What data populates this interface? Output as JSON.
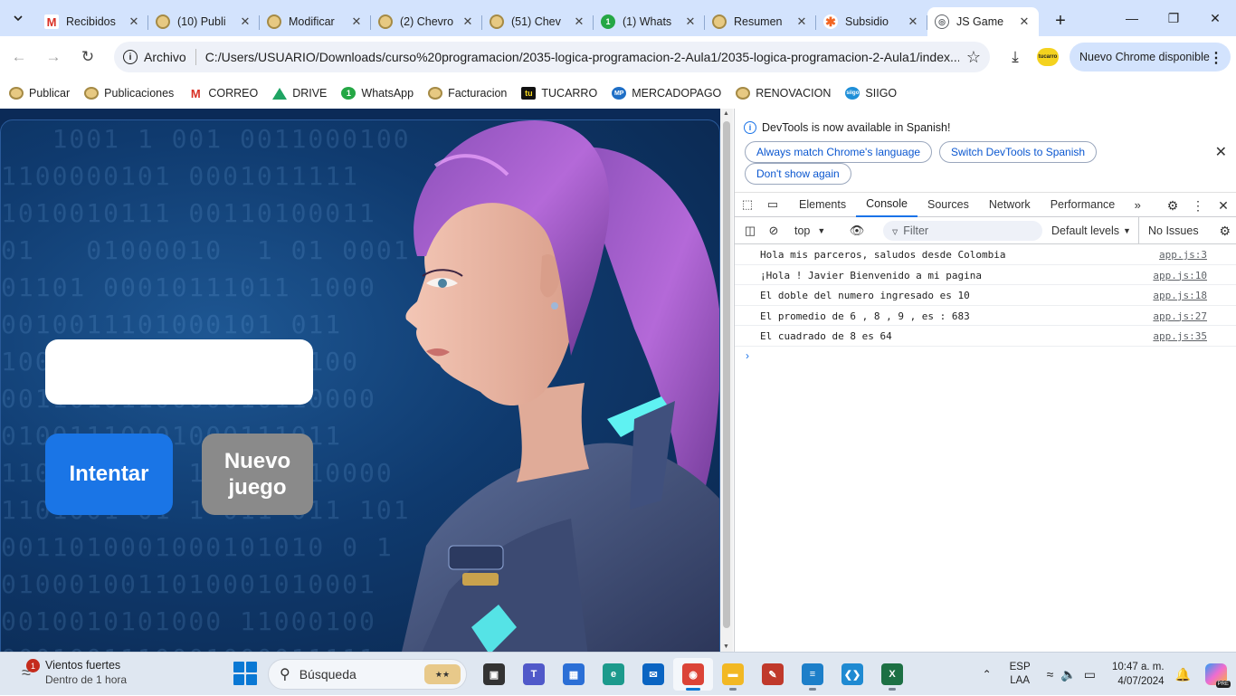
{
  "browser": {
    "tabs": [
      {
        "title": "Recibidos",
        "icon": "gmail-icon"
      },
      {
        "title": "(10) Publi",
        "icon": "coin-icon"
      },
      {
        "title": "Modificar",
        "icon": "coin-icon"
      },
      {
        "title": "(2) Chevro",
        "icon": "coin-icon"
      },
      {
        "title": "(51) Chev",
        "icon": "coin-icon"
      },
      {
        "title": "(1) Whats",
        "icon": "whatsapp-icon"
      },
      {
        "title": "Resumen",
        "icon": "coin-icon"
      },
      {
        "title": "Subsidio",
        "icon": "subsidio-icon"
      },
      {
        "title": "JS Game",
        "icon": "globe-icon",
        "active": true
      }
    ],
    "address": {
      "scheme": "Archivo",
      "url": "C:/Users/USUARIO/Downloads/curso%20programacion/2035-logica-programacion-2-Aula1/2035-logica-programacion-2-Aula1/index..."
    },
    "update_label": "Nuevo Chrome disponible",
    "extension_label": "tucarro",
    "bookmarks": [
      {
        "label": "Publicar",
        "icon": "coin-icon"
      },
      {
        "label": "Publicaciones",
        "icon": "coin-icon"
      },
      {
        "label": "CORREO",
        "icon": "gmail-icon"
      },
      {
        "label": "DRIVE",
        "icon": "drive-icon"
      },
      {
        "label": "WhatsApp",
        "icon": "whatsapp-icon"
      },
      {
        "label": "Facturacion",
        "icon": "coin-icon"
      },
      {
        "label": "TUCARRO",
        "icon": "tucarro-icon"
      },
      {
        "label": "MERCADOPAGO",
        "icon": "mercadopago-icon"
      },
      {
        "label": "RENOVACION",
        "icon": "coin-icon"
      },
      {
        "label": "SIIGO",
        "icon": "siigo-icon"
      }
    ]
  },
  "game": {
    "input_value": "",
    "try_label": "Intentar",
    "new_game_line1": "Nuevo",
    "new_game_line2": "juego",
    "binary_rows": [
      "   1001 1 001 0011000100",
      "1100000101 0001011111",
      "1010010111 00110100011",
      "01   01000010  1 01 0001",
      "01101 00010111011 1000",
      "0010011101000101 011",
      "100010011011000100100",
      "0011010110000010110000",
      "01001110001000111011",
      "1100101 01 1 0100 10000",
      "1101001 01 1 011 011 101",
      "0011010001000101010 0 1",
      "0100010011010001010001",
      "0010010101000 11000100",
      "0001001110001000011111"
    ]
  },
  "devtools": {
    "banner": {
      "message": "DevTools is now available in Spanish!",
      "btn_match": "Always match Chrome's language",
      "btn_switch": "Switch DevTools to Spanish",
      "btn_dont_show": "Don't show again"
    },
    "tabs": [
      "Elements",
      "Console",
      "Sources",
      "Network",
      "Performance"
    ],
    "active_tab": "Console",
    "context": "top",
    "filter_placeholder": "Filter",
    "levels": "Default levels",
    "issues": "No Issues",
    "logs": [
      {
        "message": "Hola mis parceros, saludos desde Colombia",
        "source": "app.js:3"
      },
      {
        "message": "¡Hola ! Javier Bienvenido a mi pagina",
        "source": "app.js:10"
      },
      {
        "message": "El doble del numero ingresado es 10",
        "source": "app.js:18"
      },
      {
        "message": "El promedio de 6 , 8 , 9 , es : 683",
        "source": "app.js:27"
      },
      {
        "message": "El cuadrado de 8 es 64",
        "source": "app.js:35"
      }
    ]
  },
  "taskbar": {
    "weather_title": "Vientos fuertes",
    "weather_sub": "Dentro de 1 hora",
    "weather_badge": "1",
    "search_placeholder": "Búsqueda",
    "apps": [
      {
        "name": "task-view",
        "color": "#333333"
      },
      {
        "name": "teams",
        "color": "#5059c9"
      },
      {
        "name": "store",
        "color": "#2b6fd6"
      },
      {
        "name": "edge",
        "color": "#1c9a8c"
      },
      {
        "name": "mail",
        "color": "#0a64c2"
      },
      {
        "name": "chrome",
        "color": "#db4437",
        "active": true
      },
      {
        "name": "file-explorer",
        "color": "#f2b824"
      },
      {
        "name": "pdf",
        "color": "#c0392b"
      },
      {
        "name": "notepad",
        "color": "#1d7fc9"
      },
      {
        "name": "vscode",
        "color": "#1f8ad2"
      },
      {
        "name": "excel",
        "color": "#1d7044"
      }
    ],
    "lang_line1": "ESP",
    "lang_line2": "LAA",
    "time": "10:47 a. m.",
    "date": "4/07/2024",
    "copilot_badge": "PRE"
  }
}
